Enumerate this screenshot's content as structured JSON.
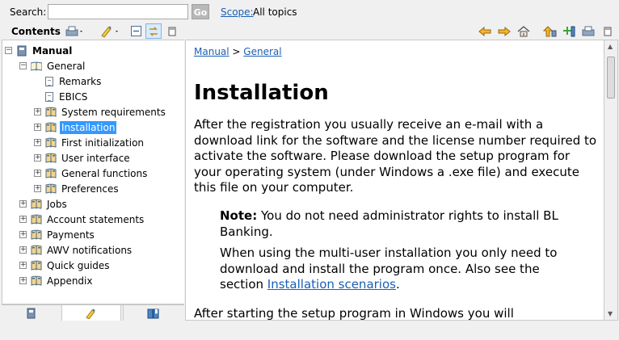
{
  "search": {
    "label": "Search:",
    "value": "",
    "placeholder": "",
    "go_label": "Go",
    "scope_link": "Scope:",
    "scope_value": "All topics"
  },
  "left_toolbar": {
    "title": "Contents",
    "icons": [
      "print-icon",
      "highlight-icon",
      "collapse-all-icon",
      "link-with-contents-icon",
      "minimize-icon"
    ]
  },
  "tree": {
    "items": [
      {
        "label": "Manual",
        "level": 0,
        "expander": "−",
        "icon": "book",
        "bold": true
      },
      {
        "label": "General",
        "level": 1,
        "expander": "−",
        "icon": "book-open"
      },
      {
        "label": "Remarks",
        "level": 2,
        "expander": "",
        "icon": "page"
      },
      {
        "label": "EBICS",
        "level": 2,
        "expander": "",
        "icon": "page"
      },
      {
        "label": "System requirements",
        "level": 2,
        "expander": "+",
        "icon": "book"
      },
      {
        "label": "Installation",
        "level": 2,
        "expander": "+",
        "icon": "book",
        "selected": true
      },
      {
        "label": "First initialization",
        "level": 2,
        "expander": "+",
        "icon": "book"
      },
      {
        "label": "User interface",
        "level": 2,
        "expander": "+",
        "icon": "book"
      },
      {
        "label": "General functions",
        "level": 2,
        "expander": "+",
        "icon": "book"
      },
      {
        "label": "Preferences",
        "level": 2,
        "expander": "+",
        "icon": "book"
      },
      {
        "label": "Jobs",
        "level": 1,
        "expander": "+",
        "icon": "book"
      },
      {
        "label": "Account statements",
        "level": 1,
        "expander": "+",
        "icon": "book"
      },
      {
        "label": "Payments",
        "level": 1,
        "expander": "+",
        "icon": "book"
      },
      {
        "label": "AWV notifications",
        "level": 1,
        "expander": "+",
        "icon": "book"
      },
      {
        "label": "Quick guides",
        "level": 1,
        "expander": "+",
        "icon": "book"
      },
      {
        "label": "Appendix",
        "level": 1,
        "expander": "+",
        "icon": "book"
      }
    ]
  },
  "tabs": [
    "contents-tab-icon",
    "search-results-tab-icon",
    "bookmarks-tab-icon"
  ],
  "right_toolbar": {
    "icons": [
      "back-icon",
      "forward-icon",
      "home-icon",
      "show-in-toc-icon",
      "bookmark-icon",
      "print-icon",
      "maximize-icon"
    ]
  },
  "content": {
    "breadcrumb": {
      "part1": "Manual",
      "sep": " > ",
      "part2": "General"
    },
    "title": "Installation",
    "para1": "After the registration you usually receive an e-mail with a download link for the software and the license number required to activate the software. Please download the setup program for your operating system (under Windows a .exe file) and execute this file on your computer.",
    "note_label": "Note:",
    "note_text": " You do not need administrator rights to install BL Banking.",
    "multi_user_text": "When using the multi-user installation you only need to download and install the program once. Also see the section ",
    "multi_user_link": "Installation scenarios",
    "multi_user_end": ".",
    "para2": "After starting the setup program in Windows you will"
  },
  "colors": {
    "selection": "#3399ff",
    "link": "#1a5fb4",
    "book_icon": "#4a6b8a"
  }
}
